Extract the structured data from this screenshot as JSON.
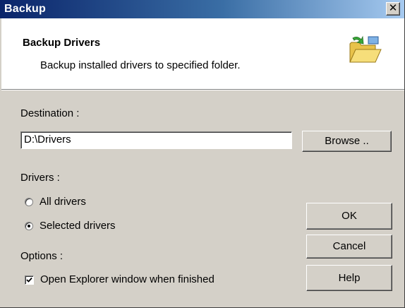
{
  "window": {
    "title": "Backup",
    "close_glyph": "✕"
  },
  "header": {
    "title": "Backup Drivers",
    "description": "Backup installed drivers to specified folder.",
    "icon": "folder-backup-icon"
  },
  "destination": {
    "label": "Destination :",
    "value": "D:\\Drivers",
    "browse_label": "Browse .."
  },
  "drivers": {
    "label": "Drivers :",
    "options": [
      {
        "label": "All drivers",
        "selected": false
      },
      {
        "label": "Selected drivers",
        "selected": true
      }
    ]
  },
  "options": {
    "label": "Options :",
    "open_explorer_label": "Open Explorer window when finished",
    "open_explorer_checked": true
  },
  "buttons": {
    "ok": "OK",
    "cancel": "Cancel",
    "help": "Help"
  },
  "colors": {
    "title_start": "#0a246a",
    "title_end": "#a6caf0",
    "face": "#d4d0c8"
  }
}
